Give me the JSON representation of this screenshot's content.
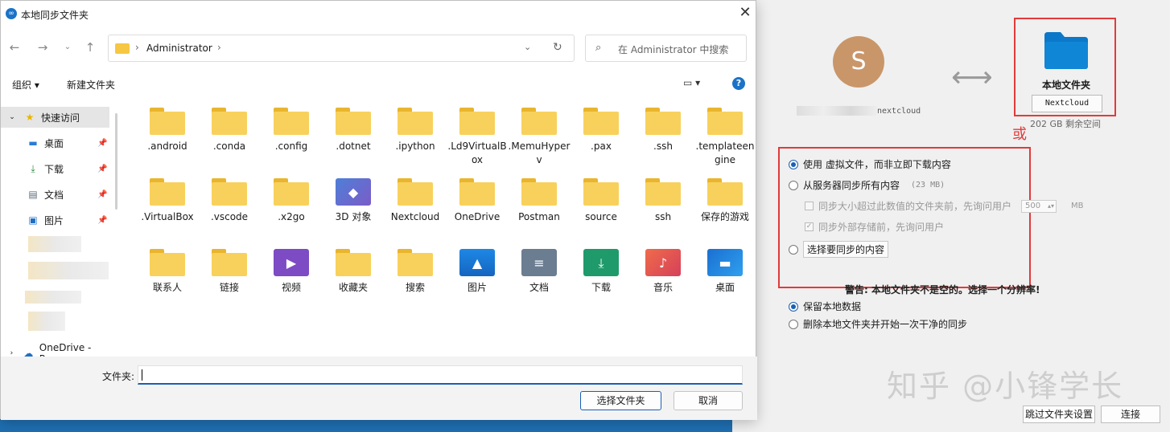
{
  "dialog": {
    "title": "本地同步文件夹",
    "address": {
      "crumb": "Administrator"
    },
    "search_placeholder": "在 Administrator 中搜索",
    "toolbar": {
      "organize": "组织 ▾",
      "new_folder": "新建文件夹"
    },
    "sidebar": {
      "quick_access": "快速访问",
      "items": [
        {
          "label": "桌面",
          "icon": "desktop-icon"
        },
        {
          "label": "下载",
          "icon": "download-icon"
        },
        {
          "label": "文档",
          "icon": "document-icon"
        },
        {
          "label": "图片",
          "icon": "picture-icon"
        }
      ],
      "onedrive": "OneDrive - Pers"
    },
    "items": [
      {
        "label": ".android",
        "type": "folder"
      },
      {
        "label": ".conda",
        "type": "folder"
      },
      {
        "label": ".config",
        "type": "folder"
      },
      {
        "label": ".dotnet",
        "type": "folder"
      },
      {
        "label": ".ipython",
        "type": "folder"
      },
      {
        "label": ".Ld9VirtualBox",
        "type": "folder"
      },
      {
        "label": ".MemuHyperv",
        "type": "folder"
      },
      {
        "label": ".pax",
        "type": "folder"
      },
      {
        "label": ".ssh",
        "type": "folder"
      },
      {
        "label": ".templateengine",
        "type": "folder"
      },
      {
        "label": ".VirtualBox",
        "type": "folder"
      },
      {
        "label": ".vscode",
        "type": "folder"
      },
      {
        "label": ".x2go",
        "type": "folder"
      },
      {
        "label": "3D 对象",
        "type": "3d"
      },
      {
        "label": "Nextcloud",
        "type": "folder"
      },
      {
        "label": "OneDrive",
        "type": "folder"
      },
      {
        "label": "Postman",
        "type": "folder"
      },
      {
        "label": "source",
        "type": "folder"
      },
      {
        "label": "ssh",
        "type": "folder"
      },
      {
        "label": "保存的游戏",
        "type": "folder"
      },
      {
        "label": "联系人",
        "type": "folder"
      },
      {
        "label": "链接",
        "type": "folder"
      },
      {
        "label": "视频",
        "type": "video"
      },
      {
        "label": "收藏夹",
        "type": "folder"
      },
      {
        "label": "搜索",
        "type": "folder"
      },
      {
        "label": "图片",
        "type": "pictures"
      },
      {
        "label": "文档",
        "type": "documents"
      },
      {
        "label": "下载",
        "type": "downloads"
      },
      {
        "label": "音乐",
        "type": "music"
      },
      {
        "label": "桌面",
        "type": "desktop"
      }
    ],
    "folder_label": "文件夹:",
    "select_button": "选择文件夹",
    "cancel_button": "取消"
  },
  "wizard": {
    "avatar_letter": "S",
    "server_suffix": "nextcloud",
    "local_folder_title": "本地文件夹",
    "local_folder_button": "Nextcloud",
    "free_space": "202 GB 剩余空间",
    "or_annotation": "或",
    "option_virtual": "使用 虚拟文件，而非立即下载内容",
    "option_sync_all": "从服务器同步所有内容",
    "sync_all_size": "(23 MB)",
    "option_ask_size": "同步大小超过此数值的文件夹前，先询问用户",
    "ask_size_value": "500",
    "ask_size_unit": "MB",
    "option_ask_external": "同步外部存储前，先询问用户",
    "option_choose": "选择要同步的内容",
    "warning": "警告: 本地文件夹不是空的。选择一个分辨率!",
    "keep_local": "保留本地数据",
    "erase_local": "删除本地文件夹并开始一次干净的同步",
    "skip_button": "跳过文件夹设置",
    "connect_button": "连接",
    "watermark": "知乎 @小锋学长",
    "colors": {
      "accent": "#1a5fb4",
      "highlight": "#e23a3a",
      "folder": "#f8d15c",
      "nc_folder": "#0b78c9"
    }
  }
}
